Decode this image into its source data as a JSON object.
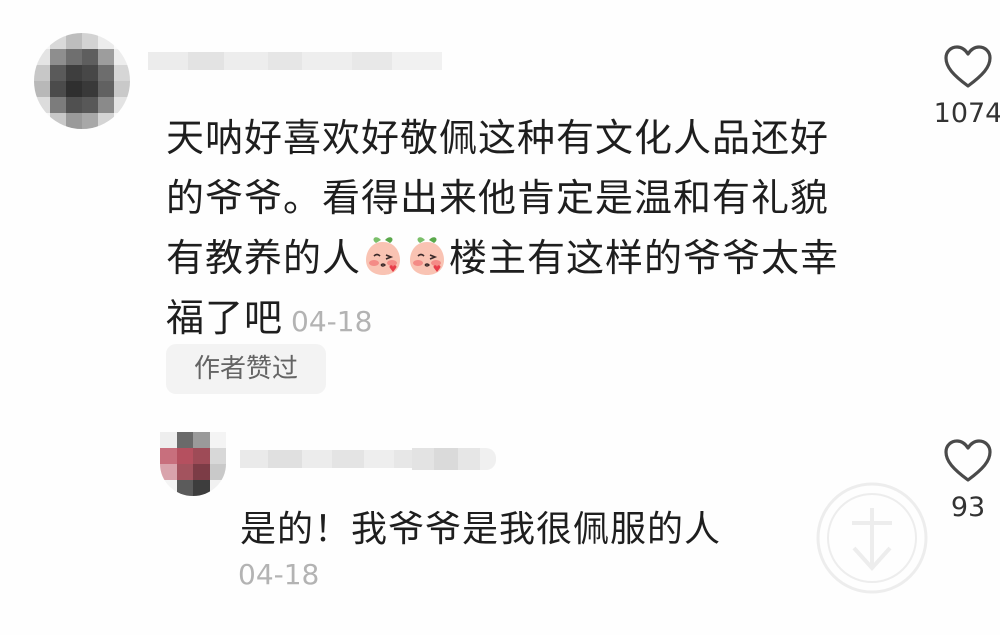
{
  "comment": {
    "lines": [
      "天呐好喜欢好敬佩这种有文化人品还好",
      "的爷爷。看得出来他肯定是温和有礼貌",
      "有教养的人",
      "楼主有这样的爷爷太幸",
      "福了吧"
    ],
    "emoji": "blushing-peach-emoji",
    "time": "04-18",
    "like_count": "1074",
    "author_liked_label": "作者赞过"
  },
  "reply": {
    "text": "是的！我爷爷是我很佩服的人",
    "time": "04-18",
    "like_count": "93"
  },
  "icons": {
    "like": "heart-outline-icon",
    "watermark": "watermark-logo"
  },
  "colors": {
    "text": "#1e1e1e",
    "meta": "#b3b3b3",
    "badge_bg": "#f3f3f3",
    "emoji": "#f6b1a4"
  }
}
